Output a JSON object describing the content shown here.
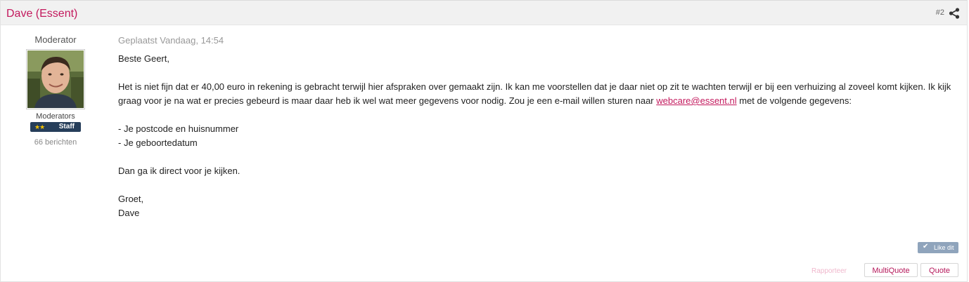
{
  "post": {
    "author": "Dave (Essent)",
    "post_number": "#2",
    "role_title": "Moderator",
    "group": "Moderators",
    "badge": {
      "stars": "★★",
      "label": "Staff"
    },
    "post_count": "66 berichten",
    "posted": "Geplaatst Vandaag, 14:54",
    "body": {
      "greeting": "Beste Geert,",
      "para1_before": "Het is niet fijn dat er 40,00 euro in rekening is gebracht terwijl hier afspraken over gemaakt zijn. Ik kan me voorstellen dat je daar niet op zit te wachten terwijl er bij een verhuizing al zoveel komt kijken. Ik kijk graag voor je na wat er precies gebeurd is maar daar heb ik wel wat meer gegevens voor nodig. Zou je een e-mail willen sturen naar ",
      "email": "webcare@essent.nl",
      "para1_after": " met de volgende gegevens:",
      "item1": "- Je postcode en huisnummer",
      "item2": "- Je geboortedatum",
      "para2": "Dan ga ik direct voor je kijken.",
      "closing": "Groet,",
      "signature": "Dave"
    }
  },
  "actions": {
    "like": "Like dit",
    "report": "Rapporteer",
    "multiquote": "MultiQuote",
    "quote": "Quote"
  },
  "icons": {
    "share": "share-icon",
    "like": "check-icon",
    "avatar": "user-photo"
  },
  "colors": {
    "accent": "#c3195d",
    "badge_bg": "#263e5a",
    "like_bg": "#8fa4bc"
  }
}
